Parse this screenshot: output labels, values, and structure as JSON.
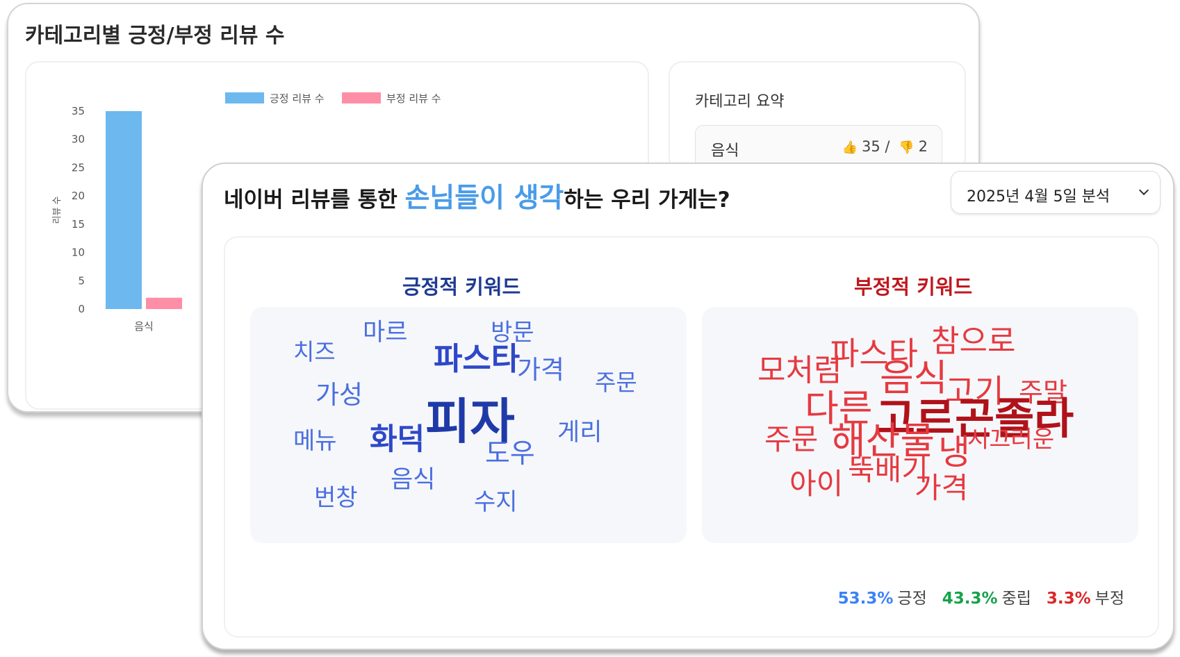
{
  "back_card": {
    "title": "카테고리별 긍정/부정 리뷰 수",
    "summary": {
      "title": "카테고리 요약",
      "rows": [
        {
          "category": "음식",
          "positive": "35 /",
          "negative": "2"
        }
      ]
    }
  },
  "chart_data": {
    "type": "bar",
    "categories": [
      "음식"
    ],
    "series": [
      {
        "name": "긍정 리뷰 수",
        "values": [
          35
        ],
        "color": "#6cb8ef"
      },
      {
        "name": "부정 리뷰 수",
        "values": [
          2
        ],
        "color": "#fe8ea6"
      }
    ],
    "ylabel": "리뷰 수",
    "ylim": [
      0,
      35
    ],
    "yticks": [
      "35",
      "30",
      "25",
      "20",
      "15",
      "10",
      "5",
      "0"
    ],
    "legend": "top"
  },
  "front_card": {
    "title_before": "네이버 리뷰를 통한 ",
    "title_highlight": "손님들이 생각",
    "title_after": "하는 우리 가게는?",
    "date_select": "2025년 4월 5일 분석",
    "positive_heading": "긍정적 키워드",
    "negative_heading": "부정적 키워드",
    "positive_words": [
      "마르",
      "방문",
      "치즈",
      "파스타",
      "가격",
      "주문",
      "가성",
      "피자",
      "메뉴",
      "화덕",
      "도우",
      "게리",
      "음식",
      "번창",
      "수지"
    ],
    "negative_words": [
      "참으로",
      "파스타",
      "모처럼",
      "음식",
      "고기",
      "주말",
      "다른",
      "고르곤졸라",
      "주문",
      "해산물",
      "시끄러운",
      "냉",
      "뚝배기",
      "아이",
      "가격"
    ],
    "stats": {
      "positive_pct": "53.3%",
      "positive_label": "긍정",
      "neutral_pct": "43.3%",
      "neutral_label": "중립",
      "negative_pct": "3.3%",
      "negative_label": "부정",
      "positive_color": "#3b82f6",
      "neutral_color": "#16a34a",
      "negative_color": "#dc2626"
    }
  }
}
